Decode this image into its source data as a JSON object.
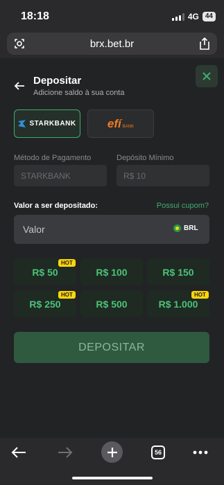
{
  "status_bar": {
    "time": "18:18",
    "network": "4G",
    "battery": "44"
  },
  "browser": {
    "url": "brx.bet.br"
  },
  "modal": {
    "title": "Depositar",
    "subtitle": "Adicione saldo à sua conta",
    "payment_methods": [
      {
        "name": "STARKBANK",
        "selected": true
      },
      {
        "name": "efí",
        "sub": "BANK",
        "selected": false
      }
    ],
    "payment_method_label": "Método de Pagamento",
    "payment_method_value": "STARKBANK",
    "min_deposit_label": "Depósito Mínimo",
    "min_deposit_value": "R$ 10",
    "amount_label": "Valor a ser depositado:",
    "coupon_link": "Possui cupom?",
    "amount_placeholder": "Valor",
    "currency": "BRL",
    "presets": [
      {
        "label": "R$ 50",
        "hot": "HOT"
      },
      {
        "label": "R$ 100"
      },
      {
        "label": "R$ 150"
      },
      {
        "label": "R$ 250",
        "hot": "HOT"
      },
      {
        "label": "R$ 500"
      },
      {
        "label": "R$ 1.000",
        "hot": "HOT"
      }
    ],
    "deposit_button": "DEPOSITAR"
  },
  "bottom_bar": {
    "tab_count": "56"
  },
  "colors": {
    "accent": "#3fae70",
    "hot_badge": "#ffd60a",
    "background": "#222325"
  }
}
